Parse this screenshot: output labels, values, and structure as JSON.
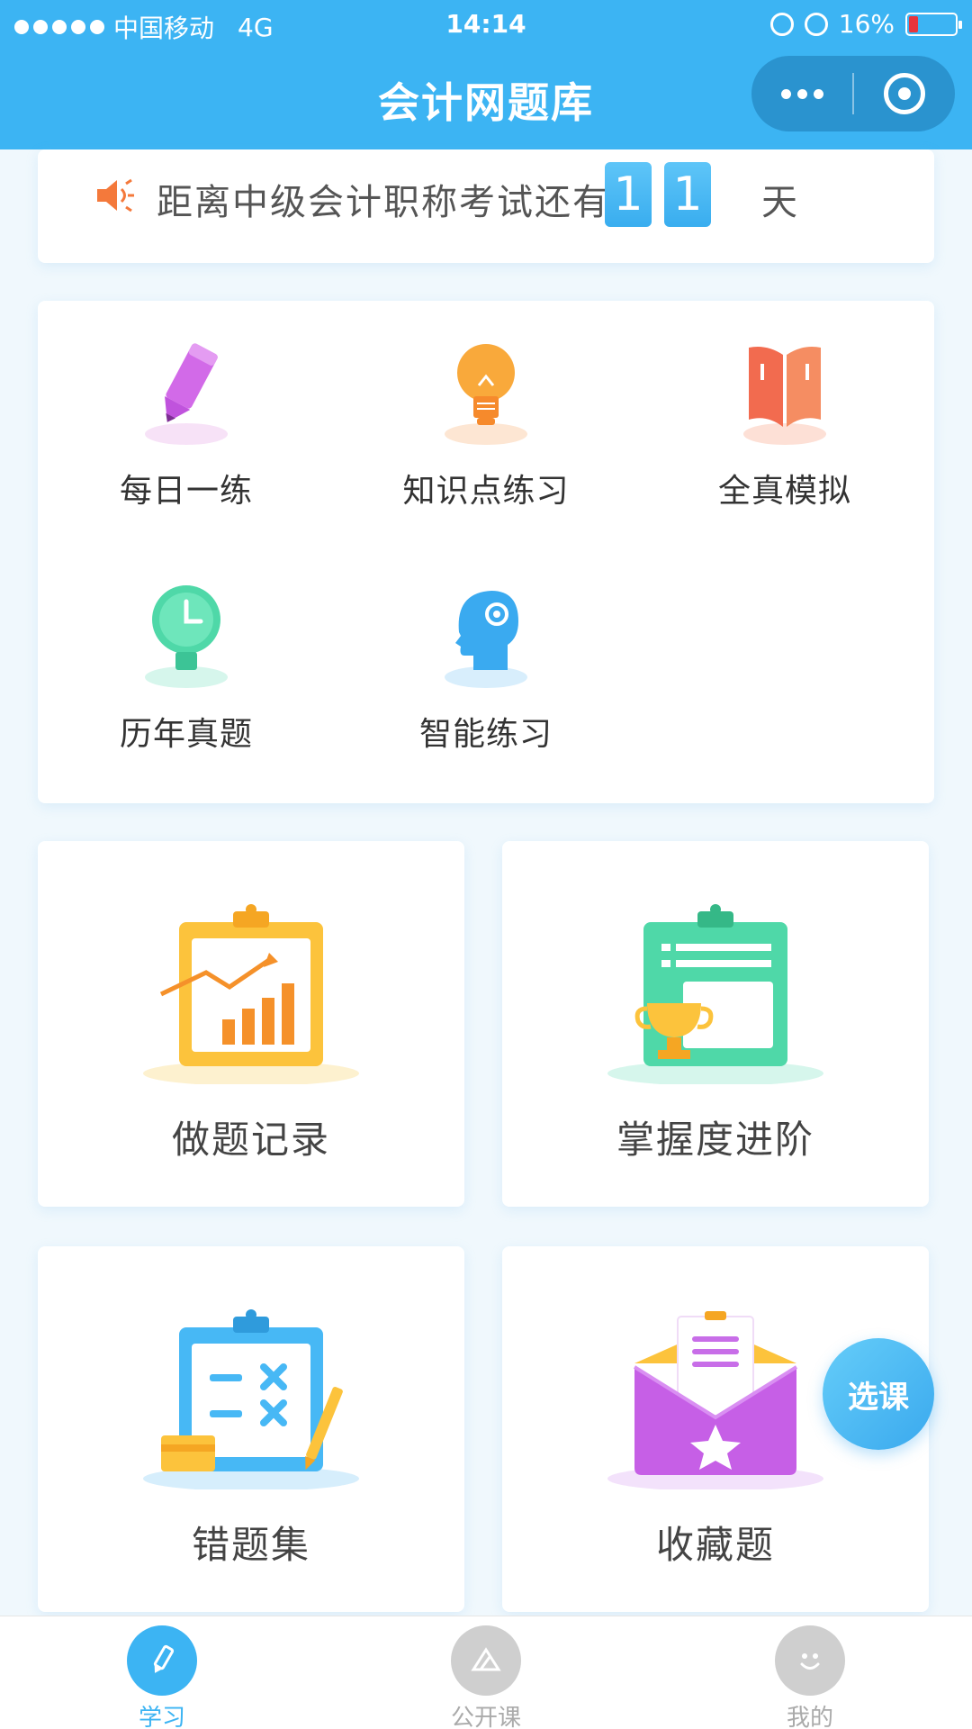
{
  "status_bar": {
    "carrier": "中国移动",
    "network": "4G",
    "time": "14:14",
    "battery": "16%",
    "battery_level_fraction": 0.16
  },
  "nav": {
    "title": "会计网题库",
    "more_icon": "more-dots-icon",
    "close_icon": "target-icon"
  },
  "countdown": {
    "prefix": "距离中级会计职称考试还有",
    "digits": [
      "1",
      "1"
    ],
    "suffix": "天",
    "icon": "speaker-icon"
  },
  "grid": {
    "items": [
      {
        "label": "每日一练",
        "icon": "pencil-icon"
      },
      {
        "label": "知识点练习",
        "icon": "lightbulb-icon"
      },
      {
        "label": "全真模拟",
        "icon": "book-icon"
      },
      {
        "label": "历年真题",
        "icon": "clock-icon"
      },
      {
        "label": "智能练习",
        "icon": "brain-gear-icon"
      }
    ]
  },
  "features": [
    {
      "label": "做题记录",
      "icon": "chart-board-icon"
    },
    {
      "label": "掌握度进阶",
      "icon": "trophy-board-icon"
    },
    {
      "label": "错题集",
      "icon": "mistakes-board-icon"
    },
    {
      "label": "收藏题",
      "icon": "star-envelope-icon"
    }
  ],
  "fab": {
    "label": "选课"
  },
  "tabs": [
    {
      "label": "学习",
      "icon": "pen-icon",
      "active": true
    },
    {
      "label": "公开课",
      "icon": "open-course-icon",
      "active": false
    },
    {
      "label": "我的",
      "icon": "smiley-icon",
      "active": false
    }
  ],
  "colors": {
    "primary": "#3cb4f3",
    "tab_active": "#3cb4f3",
    "tab_inactive": "#aaaaaa"
  }
}
